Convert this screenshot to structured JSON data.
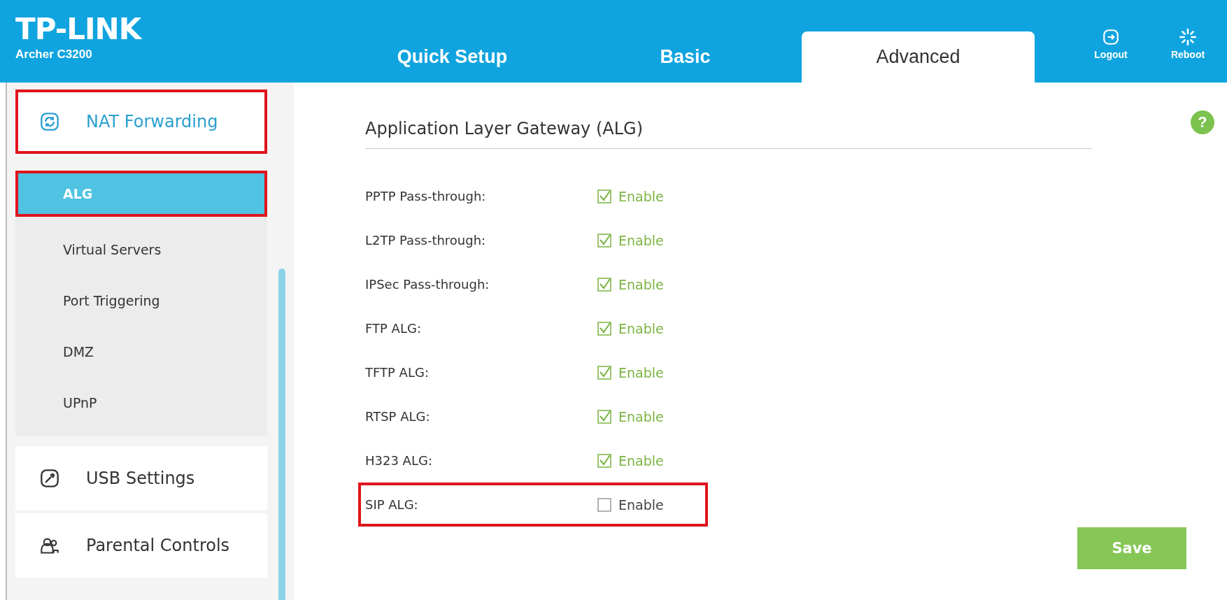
{
  "header": {
    "brand": "TP-LINK",
    "model": "Archer C3200",
    "tabs": [
      {
        "label": "Quick Setup",
        "selected": false
      },
      {
        "label": "Basic",
        "selected": false
      },
      {
        "label": "Advanced",
        "selected": true
      }
    ],
    "actions": [
      {
        "label": "Logout",
        "kind": "logout"
      },
      {
        "label": "Reboot",
        "kind": "reboot"
      }
    ]
  },
  "sidebar": {
    "items": [
      {
        "label": "NAT Forwarding",
        "kind": "nat",
        "expanded": true,
        "highlighted": true,
        "children": [
          {
            "label": "ALG",
            "selected": true,
            "highlighted": true
          },
          {
            "label": "Virtual Servers",
            "selected": false,
            "highlighted": false
          },
          {
            "label": "Port Triggering",
            "selected": false,
            "highlighted": false
          },
          {
            "label": "DMZ",
            "selected": false,
            "highlighted": false
          },
          {
            "label": "UPnP",
            "selected": false,
            "highlighted": false
          }
        ]
      },
      {
        "label": "USB Settings",
        "kind": "usb",
        "expanded": false,
        "highlighted": false
      },
      {
        "label": "Parental Controls",
        "kind": "parental",
        "expanded": false,
        "highlighted": false
      }
    ]
  },
  "main": {
    "title": "Application Layer Gateway (ALG)",
    "help": "?",
    "rows": [
      {
        "label": "PPTP Pass-through:",
        "option": "Enable",
        "checked": true,
        "highlighted": false
      },
      {
        "label": "L2TP Pass-through:",
        "option": "Enable",
        "checked": true,
        "highlighted": false
      },
      {
        "label": "IPSec Pass-through:",
        "option": "Enable",
        "checked": true,
        "highlighted": false
      },
      {
        "label": "FTP ALG:",
        "option": "Enable",
        "checked": true,
        "highlighted": false
      },
      {
        "label": "TFTP ALG:",
        "option": "Enable",
        "checked": true,
        "highlighted": false
      },
      {
        "label": "RTSP ALG:",
        "option": "Enable",
        "checked": true,
        "highlighted": false
      },
      {
        "label": "H323 ALG:",
        "option": "Enable",
        "checked": true,
        "highlighted": false
      },
      {
        "label": "SIP ALG:",
        "option": "Enable",
        "checked": false,
        "highlighted": true
      }
    ],
    "save": "Save"
  }
}
